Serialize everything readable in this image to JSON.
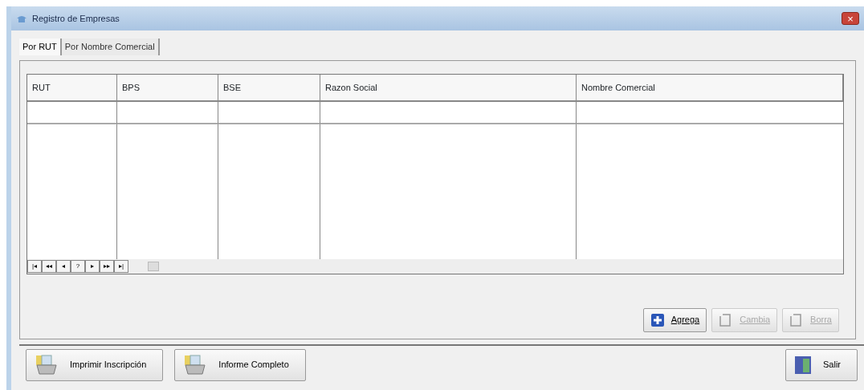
{
  "window": {
    "title": "Registro de Empresas",
    "close": "×"
  },
  "tabs": [
    {
      "label": "Por RUT",
      "selected": true
    },
    {
      "label": "Por Nombre Comercial",
      "selected": false
    }
  ],
  "table": {
    "columns": [
      "RUT",
      "BPS",
      "BSE",
      "Razon Social",
      "Nombre Comercial"
    ]
  },
  "pager": [
    "|◂",
    "◂◂",
    "◂",
    "?",
    "▸",
    "▸▸",
    "▸|"
  ],
  "record_buttons": [
    {
      "label": "Agrega",
      "kind": "add",
      "disabled": false
    },
    {
      "label": "Cambia",
      "kind": "edit",
      "disabled": true
    },
    {
      "label": "Borra",
      "kind": "delete",
      "disabled": true
    }
  ],
  "footer_buttons": [
    {
      "label": "Imprimir Inscripción",
      "kind": "print"
    },
    {
      "label": "Informe Completo",
      "kind": "print"
    },
    {
      "label": "Salir",
      "kind": "exit"
    }
  ]
}
